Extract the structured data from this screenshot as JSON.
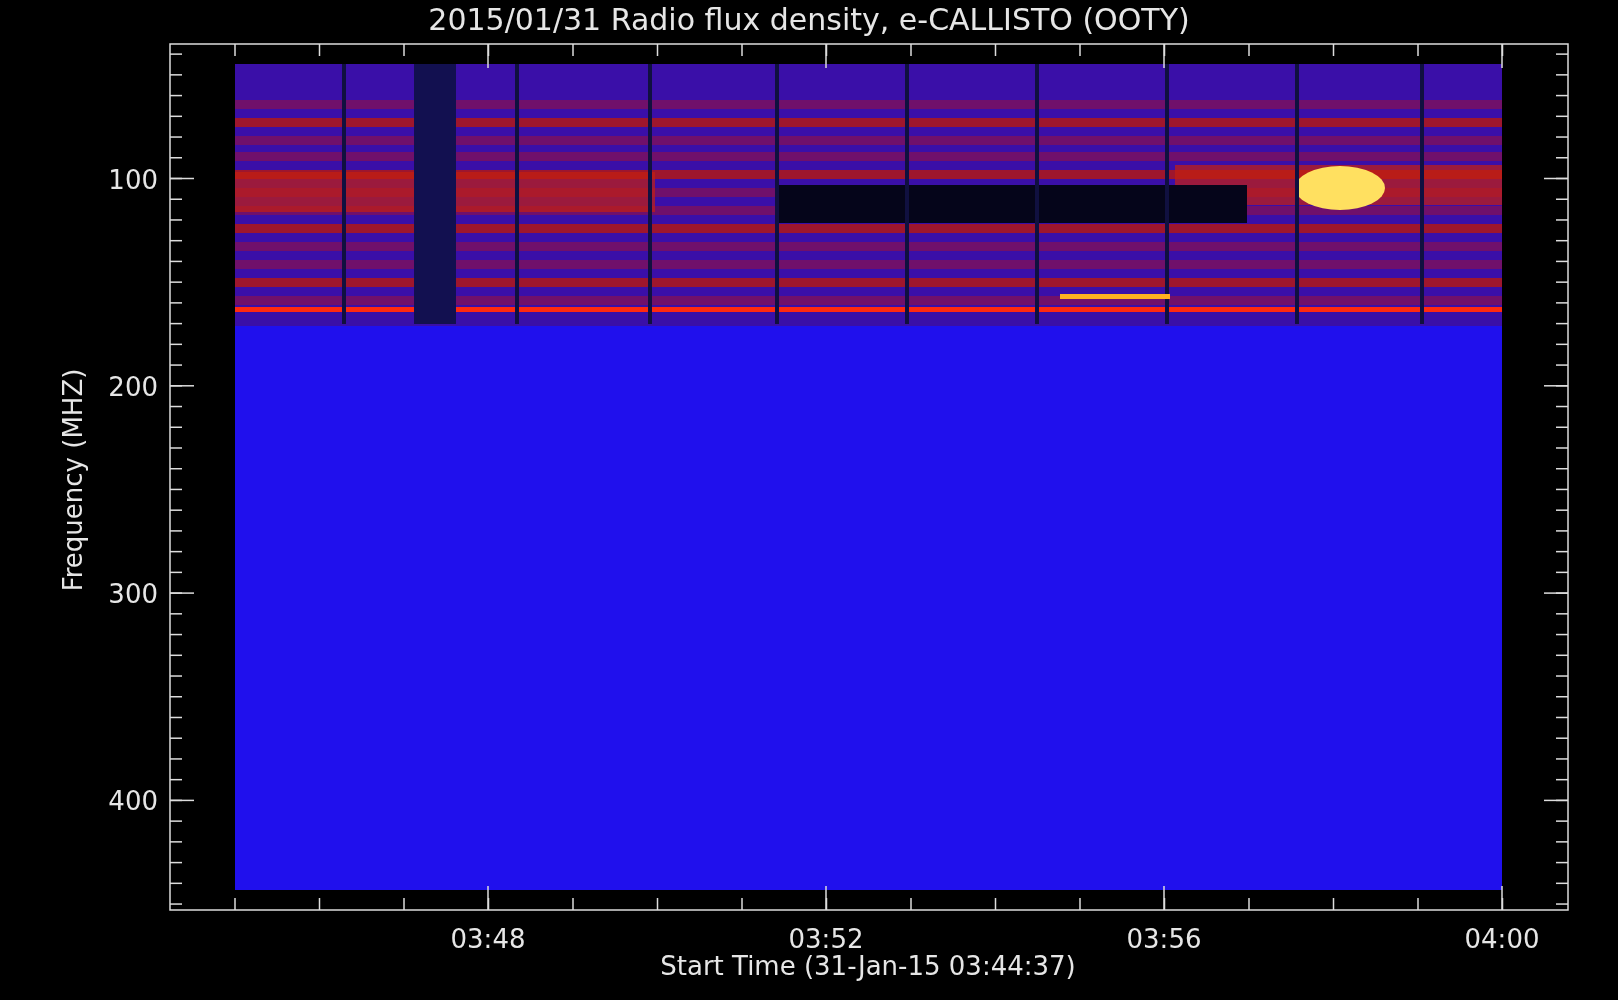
{
  "title": "2015/01/31  Radio flux density, e-CALLISTO (OOTY)",
  "y_axis": {
    "label": "Frequency (MHZ)",
    "ticks": [
      "100",
      "200",
      "300",
      "400"
    ]
  },
  "x_axis": {
    "label": "Start Time (31-Jan-15 03:44:37)",
    "ticks": [
      "03:48",
      "03:52",
      "03:56",
      "04:00"
    ]
  }
}
